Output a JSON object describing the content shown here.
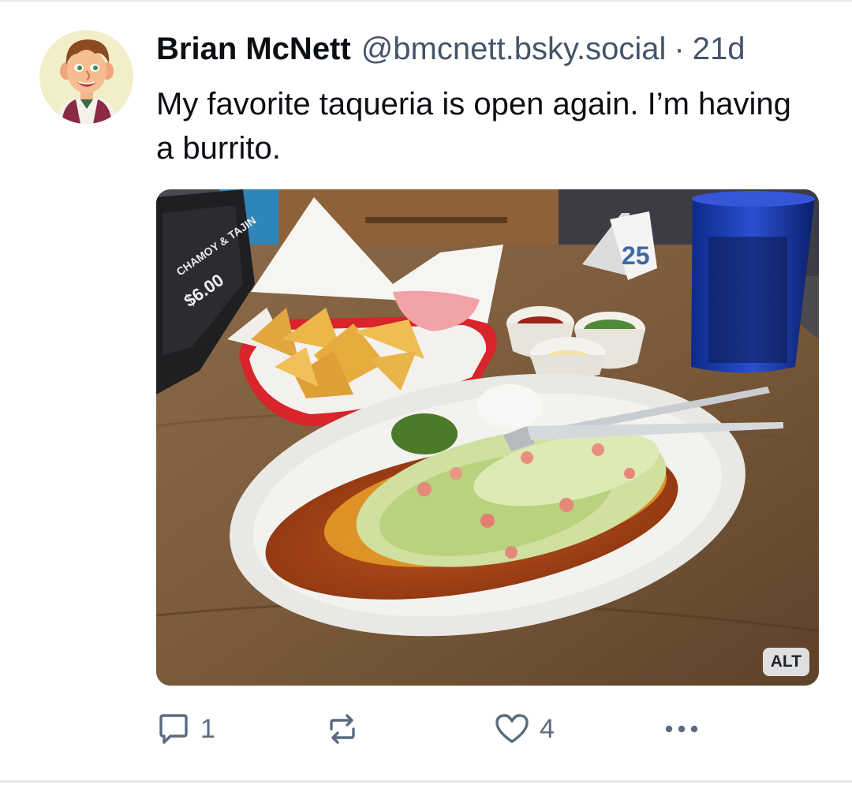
{
  "post": {
    "author_name": "Brian McNett",
    "author_handle": "@bmcnett.bsky.social",
    "separator": "·",
    "time": "21d",
    "text": "My favorite taqueria is open again. I’m having a burrito."
  },
  "media": {
    "alt_badge": "ALT",
    "photo_text": {
      "table_number": "25",
      "sign_line1": "CHAMOY & TAJIN",
      "sign_price": "$6.00"
    }
  },
  "actions": {
    "reply_count": "1",
    "like_count": "4"
  },
  "icons": {
    "reply": "speech-bubble-icon",
    "repost": "repost-arrows-icon",
    "like": "heart-icon",
    "more": "ellipsis-icon"
  },
  "colors": {
    "text_primary": "#0b0f14",
    "text_secondary": "#44546a",
    "action_icons": "#5b6b80"
  }
}
